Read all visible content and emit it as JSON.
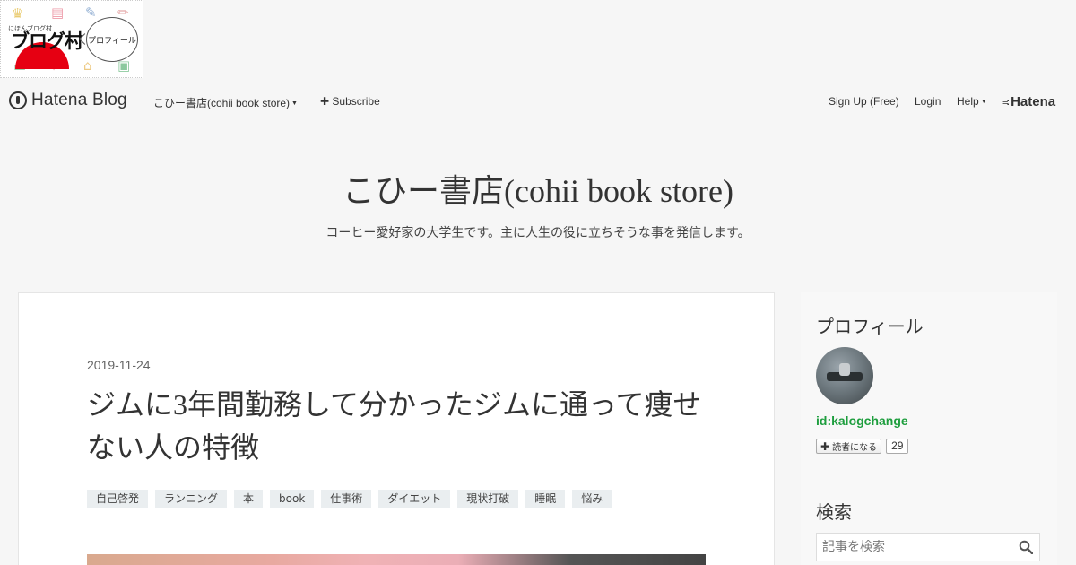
{
  "banner": {
    "small_text": "にほんブログ村",
    "logo_text": "ブログ村",
    "bubble_text": "プロフィール"
  },
  "global_header": {
    "brand": "Hatena Blog",
    "blog_menu": "こひー書店(cohii book store)",
    "subscribe": "Subscribe",
    "signup": "Sign Up (Free)",
    "login": "Login",
    "help": "Help",
    "hatena": "Hatena"
  },
  "blog": {
    "title": "こひー書店(cohii book store)",
    "description": "コーヒー愛好家の大学生です。主に人生の役に立ちそうな事を発信します。"
  },
  "entry": {
    "date": "2019-11-24",
    "title": "ジムに3年間勤務して分かったジムに通って痩せない人の特徴",
    "tags": [
      "自己啓発",
      "ランニング",
      "本",
      "book",
      "仕事術",
      "ダイエット",
      "現状打破",
      "睡眠",
      "悩み"
    ]
  },
  "sidebar": {
    "profile_heading": "プロフィール",
    "user_id": "id:kalogchange",
    "reader_button": "読者になる",
    "reader_count": "29",
    "search_heading": "検索",
    "search_placeholder": "記事を検索"
  },
  "colors": {
    "user_id": "#1e9e3e",
    "background": "#f6f6f6",
    "tag_bg": "#eaeef0"
  }
}
